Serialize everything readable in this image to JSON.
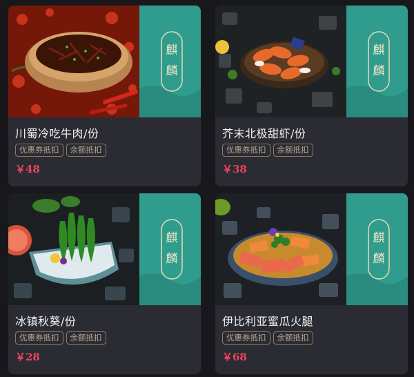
{
  "dishes": [
    {
      "name": "川蜀冷吃牛肉/份",
      "price": "￥48",
      "tags": [
        "优惠券抵扣",
        "余额抵扣"
      ],
      "logo_text": "麒麟",
      "photo": "spicy-beef-bowl"
    },
    {
      "name": "芥末北极甜虾/份",
      "price": "￥38",
      "tags": [
        "优惠券抵扣",
        "余额抵扣"
      ],
      "logo_text": "麒麟",
      "photo": "arctic-shrimp-plate"
    },
    {
      "name": "冰镇秋葵/份",
      "price": "￥28",
      "tags": [
        "优惠券抵扣",
        "余额抵扣"
      ],
      "logo_text": "麒麟",
      "photo": "iced-okra-bowl"
    },
    {
      "name": "伊比利亚蜜瓜火腿",
      "price": "￥68",
      "tags": [
        "优惠券抵扣",
        "余额抵扣"
      ],
      "logo_text": "麒麟",
      "photo": "melon-ham-plate"
    }
  ],
  "colors": {
    "page_bg": "#18181c",
    "card_bg": "#2b2c33",
    "brand_teal": "#2f9c8d",
    "price": "#f0425a",
    "tag_border": "#8a7a66"
  }
}
